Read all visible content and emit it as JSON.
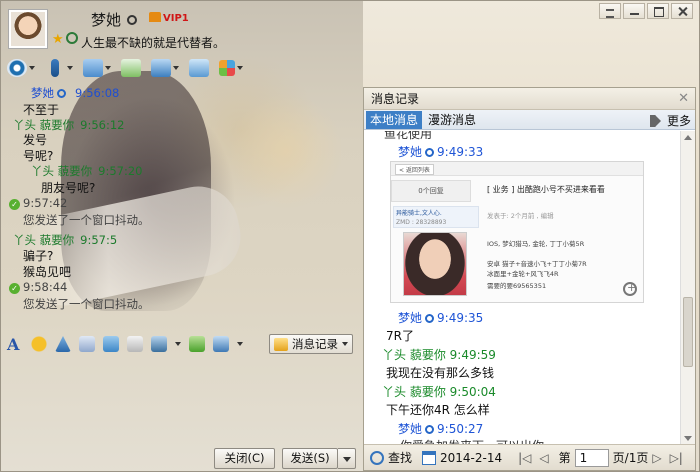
{
  "header": {
    "nickname": "梦她",
    "vip_label": "VIP1",
    "signature": "人生最不缺的就是代替者。"
  },
  "chat": {
    "messages": [
      {
        "name": "梦她",
        "time": "9:56:08",
        "color": "blue",
        "lines": [
          "不至于",
          "发号",
          "号呢?"
        ]
      },
      {
        "name": "丫头   藐要你",
        "time": "9:56:12",
        "color": "green"
      },
      {
        "name": "丫头   藐要你",
        "time": "9:57:20",
        "color": "green",
        "lines": [
          "朋友号呢?"
        ]
      },
      {
        "system_time": "9:57:42",
        "system_text": "您发送了一个窗口抖动。"
      },
      {
        "name": "丫头   藐要你",
        "time": "9:57:5",
        "color": "green",
        "lines": [
          "骗子?",
          "猴岛见吧"
        ]
      },
      {
        "system_time": "9:58:44",
        "system_text": "您发送了一个窗口抖动。"
      }
    ]
  },
  "toolbar": {
    "history_label": "消息记录",
    "close_label": "关闭(C)",
    "send_label": "发送(S)"
  },
  "history": {
    "title": "消息记录",
    "tab_local": "本地消息",
    "tab_roam": "漫游消息",
    "more_label": "更多",
    "cut_text": "鱼花使用",
    "entries": [
      {
        "name": "梦她",
        "time": "9:49:33",
        "color": "blue"
      },
      {
        "name": "梦她",
        "time": "9:49:35",
        "color": "blue",
        "text": "7R了"
      },
      {
        "name": "丫头   藐要你",
        "time": "9:49:59",
        "color": "green",
        "text": "我现在没有那么多钱"
      },
      {
        "name": "丫头   藐要你",
        "time": "9:50:04",
        "color": "green",
        "text": "下午还你4R 怎么样"
      },
      {
        "name": "梦她",
        "time": "9:50:27",
        "color": "blue",
        "text": "你爱急加发来下，可以出你"
      }
    ],
    "screenshot": {
      "back_label": "< 返回列表",
      "tab_label": "0个回复",
      "title": "[ 业务 ] 出酷跑小号不买进来看看",
      "user_line1": "异能骑士,文人心.",
      "user_line2": "ZMD : 28328893",
      "lines": [
        "发表于: 2个月前    , 编辑",
        "IOS, 梦幻猎马, 金轮, 丁丁小菊5R",
        "安卓  猫子+音速小飞+丁丁小菊7R",
        "         冰面里+金轮+风飞飞4R",
        "需要的要69565351"
      ]
    },
    "footer": {
      "find_label": "查找",
      "date": "2014-2-14",
      "page_prefix": "第",
      "page_value": "1",
      "page_suffix": "页/1页"
    }
  }
}
